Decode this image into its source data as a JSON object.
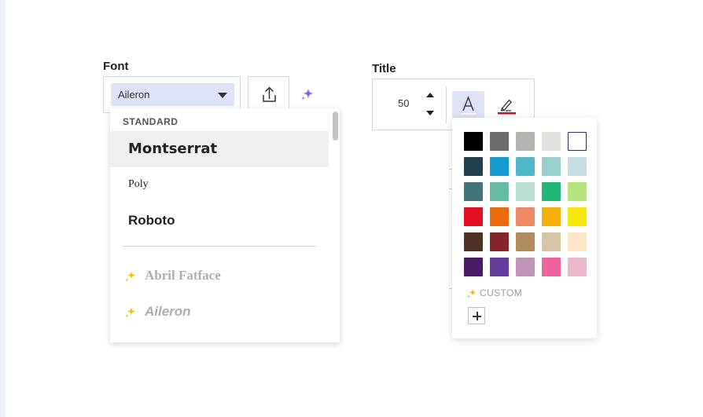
{
  "font_panel": {
    "label": "Font",
    "selected_font": "Aileron",
    "dropdown": {
      "section_header": "STANDARD",
      "standard_fonts": [
        {
          "name": "Montserrat",
          "highlighted": true
        },
        {
          "name": "Poly",
          "highlighted": false
        },
        {
          "name": "Roboto",
          "highlighted": false
        }
      ],
      "premium_fonts": [
        {
          "name": "Abril Fatface",
          "icon": "sparkle-icon"
        },
        {
          "name": "Aileron",
          "icon": "sparkle-icon"
        }
      ]
    },
    "upload_icon": "upload-icon",
    "ai_icon": "sparkle-icon"
  },
  "title_panel": {
    "label": "Title",
    "font_size": "50",
    "text_color_icon": "text-color-icon",
    "highlight_icon": "highlighter-icon",
    "highlight_color": "#c0151a"
  },
  "color_palette": {
    "rows": [
      [
        "#000000",
        "#6b6b69",
        "#b4b4b0",
        "#e3e2de",
        "#ffffff"
      ],
      [
        "#21404f",
        "#149bd1",
        "#4fb6cc",
        "#97cfcf",
        "#c4dee2"
      ],
      [
        "#41767a",
        "#66baa6",
        "#b9e0d1",
        "#21b77a",
        "#b4e47c"
      ],
      [
        "#e2101f",
        "#ea6a0e",
        "#ee8a65",
        "#f6b00b",
        "#f6e60a"
      ],
      [
        "#4f3324",
        "#87262a",
        "#b38b5d",
        "#d7c4a7",
        "#fde4c5"
      ],
      [
        "#4a1a66",
        "#673d9c",
        "#c294b6",
        "#ef63a1",
        "#ebb7cc"
      ]
    ],
    "selected_swatch": "#ffffff",
    "custom_label": "CUSTOM",
    "add_icon": "plus-icon"
  },
  "accent_color": "#dfe3f8"
}
